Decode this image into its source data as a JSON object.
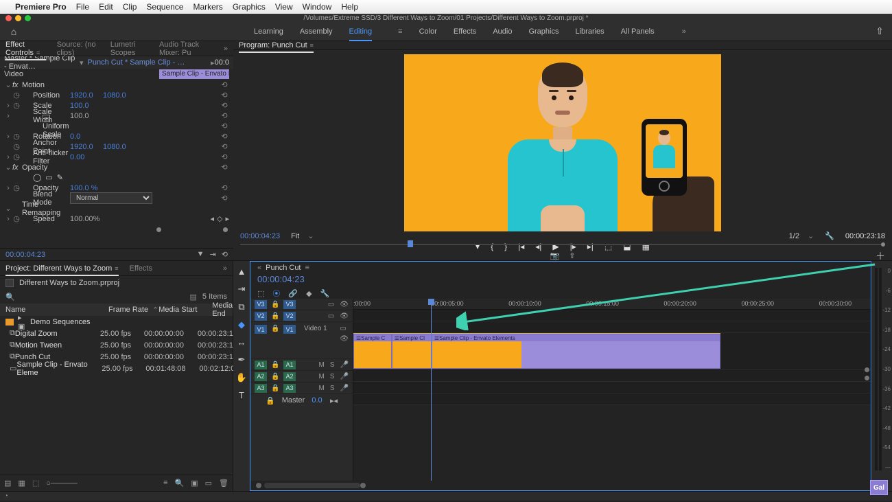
{
  "app": {
    "name": "Premiere Pro"
  },
  "menu": [
    "File",
    "Edit",
    "Clip",
    "Sequence",
    "Markers",
    "Graphics",
    "View",
    "Window",
    "Help"
  ],
  "project_path": "/Volumes/Extreme SSD/3 Different Ways to Zoom/01 Projects/Different Ways to Zoom.prproj *",
  "workspaces": [
    "Learning",
    "Assembly",
    "Editing",
    "Color",
    "Effects",
    "Audio",
    "Graphics",
    "Libraries",
    "All Panels"
  ],
  "workspace_active": "Editing",
  "top_tabs": {
    "left": [
      "Effect Controls",
      "Source: (no clips)",
      "Lumetri Scopes",
      "Audio Track Mixer: Pu"
    ],
    "left_active": "Effect Controls",
    "program_label": "Program: Punch Cut"
  },
  "effect_controls": {
    "master": "Master * Sample Clip - Envat…",
    "sequence": "Punch Cut * Sample Clip - …",
    "tc_in": "00:0",
    "video_label": "Video",
    "clip_chip": "Sample Clip - Envato Elemen",
    "motion": {
      "label": "Motion",
      "position_label": "Position",
      "position_x": "1920.0",
      "position_y": "1080.0",
      "scale_label": "Scale",
      "scale": "100.0",
      "scalew_label": "Scale Width",
      "scalew": "100.0",
      "uniform_label": "Uniform Scale",
      "rotation_label": "Rotation",
      "rotation": "0.0",
      "anchor_label": "Anchor Point",
      "anchor_x": "1920.0",
      "anchor_y": "1080.0",
      "flicker_label": "Anti-flicker Filter",
      "flicker": "0.00"
    },
    "opacity": {
      "label": "Opacity",
      "opacity_label": "Opacity",
      "opacity": "100.0 %",
      "blend_label": "Blend Mode",
      "blend": "Normal"
    },
    "time": {
      "label": "Time Remapping",
      "speed_label": "Speed",
      "speed": "100.00%"
    },
    "footer_tc": "00:00:04:23"
  },
  "program": {
    "tc": "00:00:04:23",
    "fit": "Fit",
    "fraction": "1/2",
    "duration": "00:00:23:18"
  },
  "project_panel": {
    "tab": "Project: Different Ways to Zoom",
    "effects_tab": "Effects",
    "filename": "Different Ways to Zoom.prproj",
    "item_count": "5 Items",
    "headers": {
      "name": "Name",
      "fr": "Frame Rate",
      "ms": "Media Start",
      "me": "Media End"
    },
    "rows": [
      {
        "color": "c-or",
        "icon": "▸ ▣",
        "name": "Demo Sequences",
        "fr": "",
        "ms": "",
        "me": ""
      },
      {
        "color": "c-gr",
        "icon": "⧉",
        "name": "Digital Zoom",
        "fr": "25.00 fps",
        "ms": "00:00:00:00",
        "me": "00:00:23:1"
      },
      {
        "color": "c-gr",
        "icon": "⧉",
        "name": "Motion Tween",
        "fr": "25.00 fps",
        "ms": "00:00:00:00",
        "me": "00:00:23:1"
      },
      {
        "color": "c-bl",
        "icon": "⧉",
        "name": "Punch Cut",
        "fr": "25.00 fps",
        "ms": "00:00:00:00",
        "me": "00:00:23:1"
      },
      {
        "color": "c-pu",
        "icon": "▭",
        "name": "Sample Clip - Envato Eleme",
        "fr": "25.00 fps",
        "ms": "00:01:48:08",
        "me": "00:02:12:0"
      }
    ]
  },
  "timeline": {
    "tab": "Punch Cut",
    "tc": "00:00:04:23",
    "ruler": [
      ":00:00",
      "00:00:05:00",
      "00:00:10:00",
      "00:00:15:00",
      "00:00:20:00",
      "00:00:25:00",
      "00:00:30:00"
    ],
    "tracks": {
      "v3": "V3",
      "v2": "V2",
      "v1": "V1",
      "video1": "Video 1",
      "a1": "A1",
      "a2": "A2",
      "a3": "A3",
      "master": "Master",
      "master_val": "0.0"
    },
    "track_ops": {
      "m": "M",
      "s": "S"
    },
    "clips": [
      {
        "label": "Sample C"
      },
      {
        "label": "Sample Cl"
      },
      {
        "label": "Sample Clip - Envato Elements"
      }
    ]
  },
  "meters": [
    "0",
    "-6",
    "-12",
    "-18",
    "-24",
    "-30",
    "-36",
    "-42",
    "-48",
    "-54",
    "---"
  ],
  "badge": "Gal"
}
